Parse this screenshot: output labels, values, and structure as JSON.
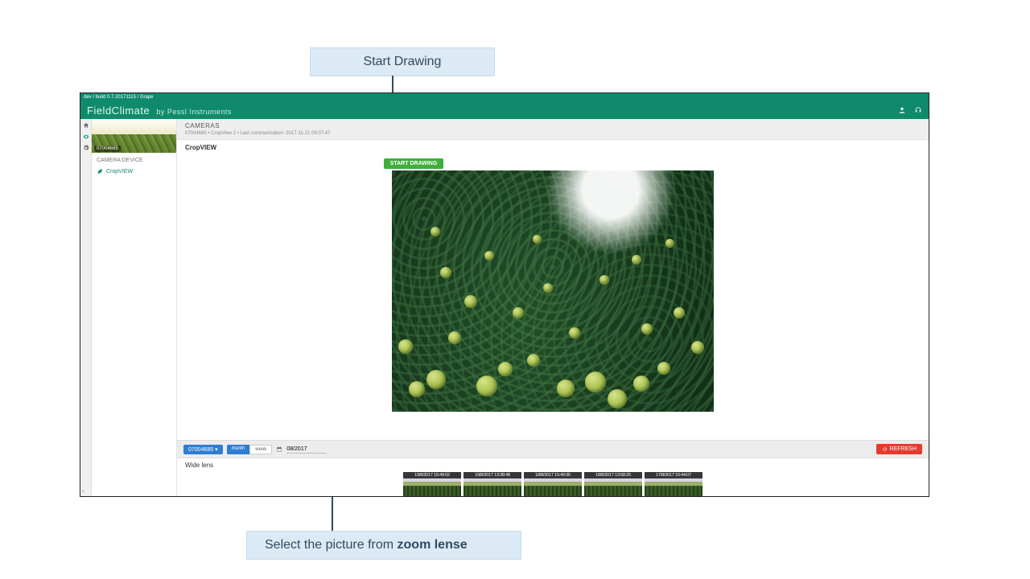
{
  "annotations": {
    "top_callout": "Start Drawing",
    "bottom_callout_prefix": "Select the picture from ",
    "bottom_callout_bold": "zoom lense"
  },
  "build_bar": "dev / build 0.7.20171115 / Grape",
  "brand": {
    "name": "FieldClimate",
    "byline": "by Pessl Instruments"
  },
  "hero_label": "07004685",
  "sidebar": {
    "section_title": "CAMERA DEVICE",
    "items": [
      {
        "label": "CropVIEW"
      }
    ]
  },
  "crumb": {
    "title": "CAMERAS",
    "sub": "07004685 • CropView 2 • Last communication: 2017-11-21 09:07:47"
  },
  "panel_title": "CropVIEW",
  "start_drawing_label": "START DRAWING",
  "filter": {
    "station_pill": "07004685 ▾",
    "seg_month": "month",
    "seg_week": "week",
    "date_value": "08/2017",
    "refresh_label": "REFRESH"
  },
  "thumbs": {
    "title": "Wide lens",
    "items": [
      "19/8/2017 15:49:02",
      "19/8/2017 13:38:48",
      "18/8/2017 15:49:35",
      "18/8/2017 13:58:25",
      "17/8/2017 15:44:07"
    ]
  }
}
